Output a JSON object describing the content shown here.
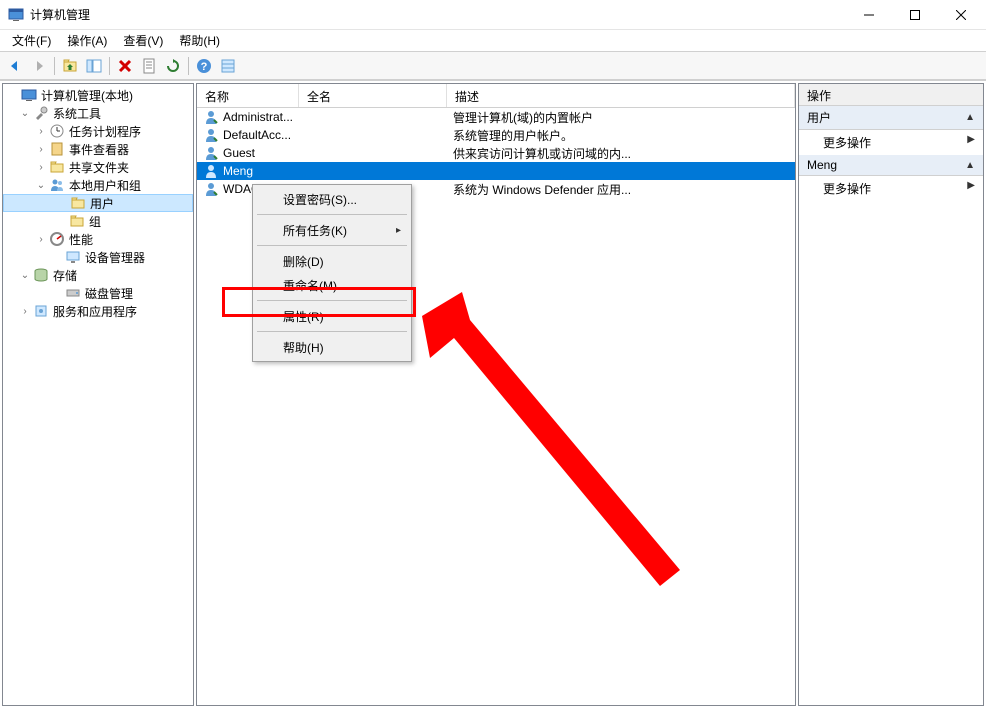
{
  "window": {
    "title": "计算机管理"
  },
  "menu": {
    "file": "文件(F)",
    "action": "操作(A)",
    "view": "查看(V)",
    "help": "帮助(H)"
  },
  "tree": {
    "root": "计算机管理(本地)",
    "system_tools": "系统工具",
    "task_scheduler": "任务计划程序",
    "event_viewer": "事件查看器",
    "shared_folders": "共享文件夹",
    "local_users_groups": "本地用户和组",
    "users": "用户",
    "groups": "组",
    "performance": "性能",
    "device_manager": "设备管理器",
    "storage": "存储",
    "disk_management": "磁盘管理",
    "services_apps": "服务和应用程序"
  },
  "list": {
    "cols": {
      "name": "名称",
      "fullname": "全名",
      "description": "描述"
    },
    "rows": [
      {
        "name": "Administrat...",
        "fullname": "",
        "desc": "管理计算机(域)的内置帐户"
      },
      {
        "name": "DefaultAcc...",
        "fullname": "",
        "desc": "系统管理的用户帐户。"
      },
      {
        "name": "Guest",
        "fullname": "",
        "desc": "供来宾访问计算机或访问域的内..."
      },
      {
        "name": "Meng",
        "fullname": "",
        "desc": ""
      },
      {
        "name": "WDAGUtilit...",
        "fullname": "",
        "desc": "系统为 Windows Defender 应用..."
      }
    ]
  },
  "context_menu": {
    "set_password": "设置密码(S)...",
    "all_tasks": "所有任务(K)",
    "delete": "删除(D)",
    "rename": "重命名(M)",
    "properties": "属性(R)",
    "help": "帮助(H)"
  },
  "actions": {
    "header": "操作",
    "section1": "用户",
    "more1": "更多操作",
    "section2": "Meng",
    "more2": "更多操作"
  }
}
